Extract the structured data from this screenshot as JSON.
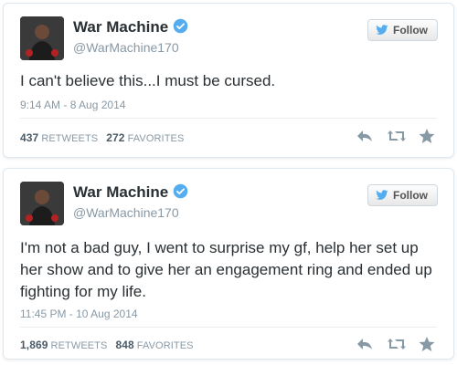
{
  "tweets": [
    {
      "name": "War Machine",
      "handle": "@WarMachine170",
      "follow_label": "Follow",
      "text": "I can't believe this...I must be cursed.",
      "time": "9:14 AM - 8 Aug 2014",
      "retweets": "437",
      "retweets_label": "RETWEETS",
      "favorites": "272",
      "favorites_label": "FAVORITES"
    },
    {
      "name": "War Machine",
      "handle": "@WarMachine170",
      "follow_label": "Follow",
      "text": "I'm not a bad guy, I went to surprise my gf, help her set up her show and to give her an engagement ring and ended up fighting for my life.",
      "time": "11:45 PM - 10 Aug 2014",
      "retweets": "1,869",
      "retweets_label": "RETWEETS",
      "favorites": "848",
      "favorites_label": "FAVORITES"
    }
  ],
  "icons": {
    "verified": "verified-badge-icon",
    "follow": "twitter-bird-icon",
    "reply": "reply-icon",
    "retweet": "retweet-icon",
    "favorite": "star-icon"
  },
  "colors": {
    "verified": "#55acee",
    "bird": "#55acee",
    "text": "#292f33",
    "muted": "#8899a6",
    "action_icon": "#8899a6"
  }
}
